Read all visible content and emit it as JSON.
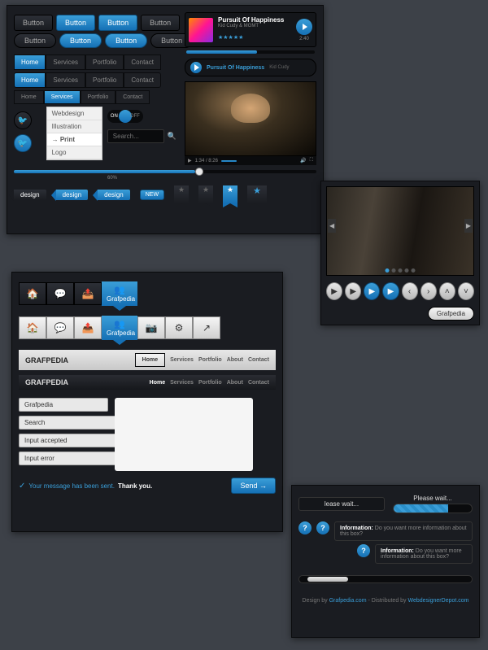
{
  "buttons": {
    "label": "Button"
  },
  "nav": {
    "home": "Home",
    "services": "Services",
    "portfolio": "Portfolio",
    "contact": "Contact",
    "about": "About"
  },
  "dropdown": {
    "webdesign": "Webdesign",
    "illustration": "Illustration",
    "print": "→ Print",
    "logo": "Logo"
  },
  "toggle": {
    "on": "ON",
    "off": "OFF"
  },
  "search": {
    "placeholder": "Search..."
  },
  "slider": {
    "value": "60%"
  },
  "tags": {
    "design": "design",
    "new": "NEW"
  },
  "player": {
    "song": "Pursuit Of Happiness",
    "artist": "Kid Cudy & MGMT",
    "artist2": "Kid Cudy",
    "duration": "2:40",
    "time": "1:34 / 8:26"
  },
  "brand": {
    "name": "Grafpedia",
    "upper": "GRAFPEDIA"
  },
  "form": {
    "input1": "Grafpedia",
    "input2": "Search",
    "accepted": "Input accepted",
    "error": "Input error",
    "success": "Your message has been sent.",
    "thanks": "Thank you.",
    "send": "Send"
  },
  "loading": {
    "wait": "Please wait...",
    "wait_lower": "lease wait..."
  },
  "info": {
    "title": "Information:",
    "text": "Do you want more information about this box?"
  },
  "footer": {
    "design": "Design by",
    "brand": "Grafpedia.com",
    "dist": "- Distributed by",
    "dist_by": "WebdesignerDepot.com"
  }
}
